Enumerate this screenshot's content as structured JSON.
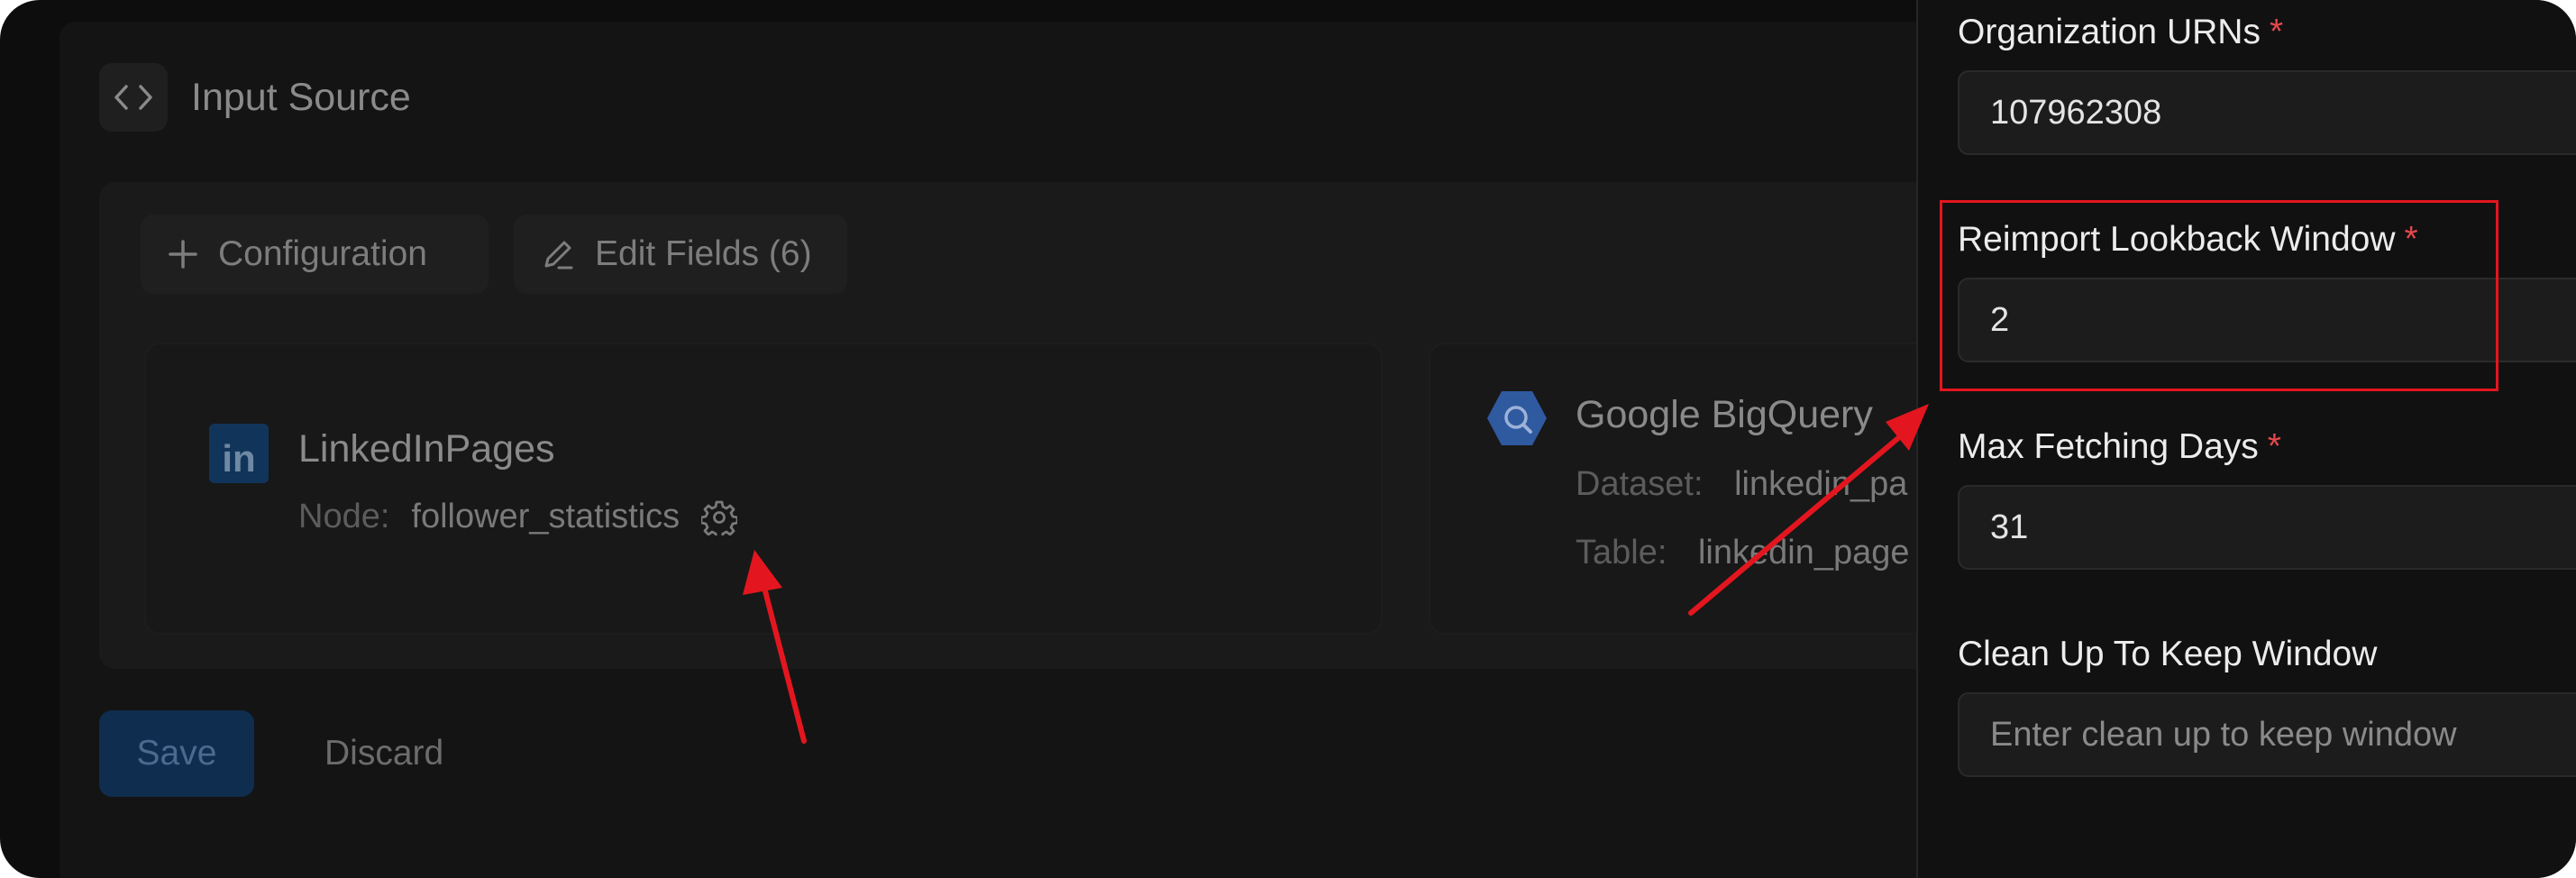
{
  "header": {
    "title": "Input Source",
    "icon": "code-brackets-icon"
  },
  "toolbar": {
    "configuration_label": "Configuration",
    "edit_fields_label": "Edit Fields (6)"
  },
  "source": {
    "name": "LinkedInPages",
    "logo_text": "in",
    "node_label": "Node:",
    "node_value": "follower_statistics"
  },
  "destination": {
    "name": "Google BigQuery",
    "dataset_label": "Dataset:",
    "dataset_value": "linkedin_pa",
    "table_label": "Table:",
    "table_value": "linkedin_page"
  },
  "actions": {
    "save_label": "Save",
    "discard_label": "Discard"
  },
  "drawer": {
    "fields": [
      {
        "label": "Organization URNs",
        "required": "*",
        "value": "107962308"
      },
      {
        "label": "Reimport Lookback Window",
        "required": "*",
        "value": "2"
      },
      {
        "label": "Max Fetching Days",
        "required": "*",
        "value": "31"
      },
      {
        "label": "Clean Up To Keep Window",
        "placeholder": "Enter clean up to keep window"
      }
    ]
  },
  "colors": {
    "annotation": "#e3161f",
    "required_asterisk": "#e5484d",
    "save_button": "#0f2d4e",
    "linkedin_brand": "#11355a"
  }
}
